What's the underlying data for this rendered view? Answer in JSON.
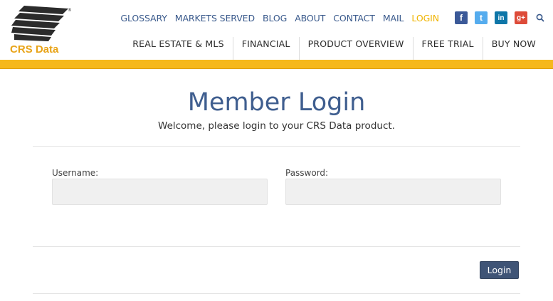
{
  "brand": {
    "name": "CRS Data"
  },
  "top_nav": [
    {
      "label": "GLOSSARY"
    },
    {
      "label": "MARKETS SERVED"
    },
    {
      "label": "BLOG"
    },
    {
      "label": "ABOUT"
    },
    {
      "label": "CONTACT"
    },
    {
      "label": "MAIL"
    },
    {
      "label": "LOGIN",
      "active": true
    }
  ],
  "social": [
    {
      "label": "f",
      "icon": "facebook-icon"
    },
    {
      "label": "t",
      "icon": "twitter-icon"
    },
    {
      "label": "in",
      "icon": "linkedin-icon"
    },
    {
      "label": "g+",
      "icon": "google-plus-icon"
    }
  ],
  "main_nav": [
    {
      "label": "REAL ESTATE & MLS"
    },
    {
      "label": "FINANCIAL"
    },
    {
      "label": "PRODUCT OVERVIEW"
    },
    {
      "label": "FREE TRIAL"
    },
    {
      "label": "BUY NOW"
    }
  ],
  "login": {
    "title": "Member Login",
    "subtitle": "Welcome, please login to your CRS Data product.",
    "username_label": "Username:",
    "username_value": "",
    "password_label": "Password:",
    "password_value": "",
    "submit_label": "Login"
  },
  "colors": {
    "accent": "#f6b81c",
    "nav_link": "#3a5a8c",
    "active_link": "#f0b400",
    "button": "#3f5476",
    "title": "#3f5e8f"
  }
}
